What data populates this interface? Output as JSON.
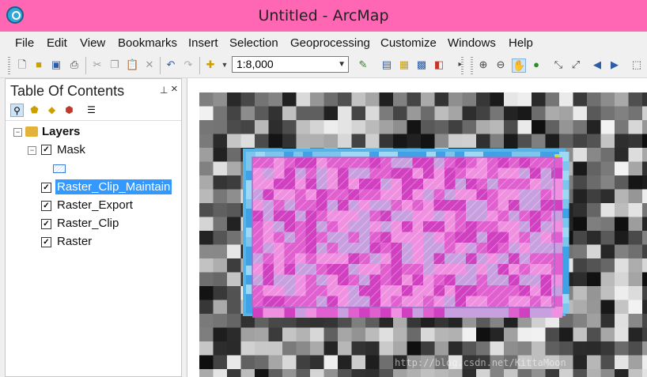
{
  "window": {
    "title": "Untitled - ArcMap"
  },
  "menu": [
    "File",
    "Edit",
    "View",
    "Bookmarks",
    "Insert",
    "Selection",
    "Geoprocessing",
    "Customize",
    "Windows",
    "Help"
  ],
  "toolbar": {
    "scale": "1:8,000",
    "icons": [
      "new-icon",
      "open-icon",
      "save-icon",
      "print-icon",
      "cut-icon",
      "copy-icon",
      "paste-icon",
      "delete-icon",
      "undo-icon",
      "redo-icon",
      "add-data-icon",
      "zoom-in-icon",
      "zoom-out-icon",
      "pan-icon",
      "full-extent-icon",
      "back-icon",
      "forward-icon"
    ]
  },
  "toc": {
    "title": "Table Of Contents",
    "group": "Layers",
    "layers": [
      {
        "name": "Mask",
        "checked": true
      },
      {
        "name": "Raster_Clip_Maintain",
        "checked": true,
        "selected": true
      },
      {
        "name": "Raster_Export",
        "checked": true
      },
      {
        "name": "Raster_Clip",
        "checked": true
      },
      {
        "name": "Raster",
        "checked": true
      }
    ]
  },
  "map": {
    "watermark": "http://blog.csdn.net/KittaMoon"
  },
  "colors": {
    "titlebar": "#ff66b3",
    "selection": "#3399ff",
    "mask_fill": "#e040c8",
    "clip_border": "#4aa8e8"
  }
}
